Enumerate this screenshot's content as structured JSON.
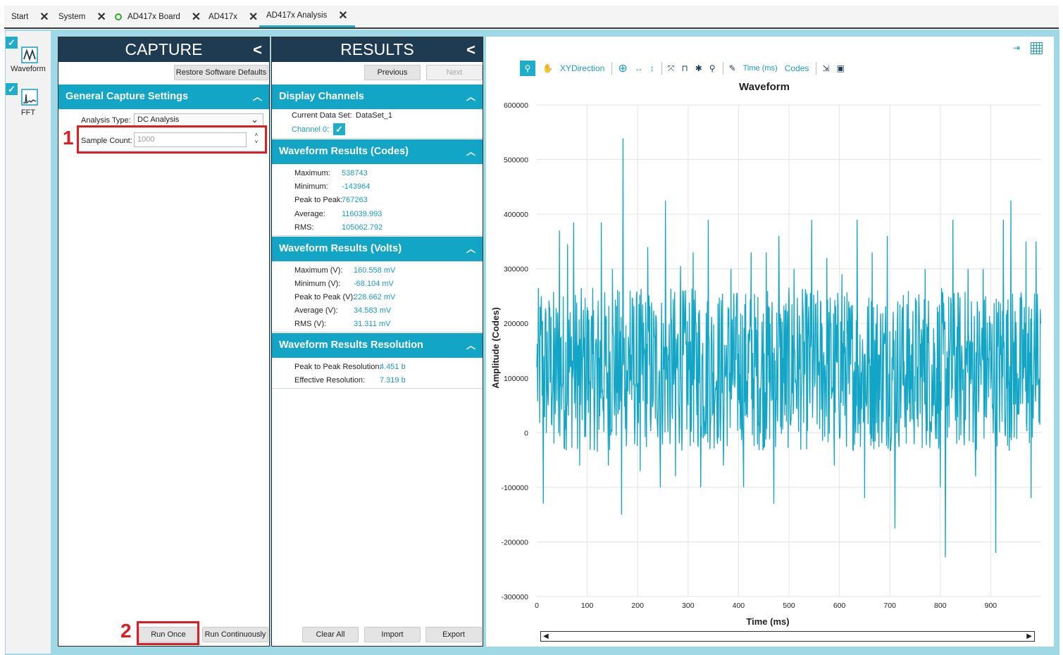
{
  "tabs": [
    {
      "label": "Start"
    },
    {
      "label": "System"
    },
    {
      "label": "AD417x Board"
    },
    {
      "label": "AD417x"
    },
    {
      "label": "AD417x Analysis"
    }
  ],
  "nav": {
    "waveform": "Waveform",
    "fft": "FFT"
  },
  "capture": {
    "title": "CAPTURE",
    "restore_label": "Restore Software Defaults",
    "section_title": "General Capture Settings",
    "analysis_type_label": "Analysis Type:",
    "analysis_type_value": "DC Analysis",
    "sample_count_label": "Sample Count:",
    "sample_count_value": "1000",
    "run_once_label": "Run Once",
    "run_continuously_label": "Run Continuously"
  },
  "annotations": {
    "marker1": "1",
    "marker2": "2"
  },
  "results": {
    "title": "RESULTS",
    "previous_label": "Previous",
    "next_label": "Next",
    "display_channels_title": "Display Channels",
    "current_dataset_label": "Current Data Set:",
    "current_dataset_value": "DataSet_1",
    "channel0_label": "Channel 0:",
    "codes_title": "Waveform Results (Codes)",
    "codes": [
      {
        "label": "Maximum:",
        "value": "538743"
      },
      {
        "label": "Minimum:",
        "value": "-143964"
      },
      {
        "label": "Peak to Peak:",
        "value": "767263"
      },
      {
        "label": "Average:",
        "value": "116039.993"
      },
      {
        "label": "RMS:",
        "value": "105062.792"
      }
    ],
    "volts_title": "Waveform Results (Volts)",
    "volts": [
      {
        "label": "Maximum (V):",
        "value": "160.558 mV"
      },
      {
        "label": "Minimum (V):",
        "value": "-68.104 mV"
      },
      {
        "label": "Peak to Peak (V):",
        "value": "228.662 mV"
      },
      {
        "label": "Average (V):",
        "value": "34.583 mV"
      },
      {
        "label": "RMS (V):",
        "value": "31.311 mV"
      }
    ],
    "resolution_title": "Waveform Results Resolution",
    "resolution": [
      {
        "label": "Peak to Peak Resolution:",
        "value": "4.451 b"
      },
      {
        "label": "Effective Resolution:",
        "value": "7.319 b"
      }
    ],
    "clear_all_label": "Clear All",
    "import_label": "Import",
    "export_label": "Export"
  },
  "toolbar": {
    "xydirection_label": "XYDirection",
    "time_label": "Time (ms)",
    "codes_label": "Codes"
  },
  "chart_data": {
    "type": "line",
    "title": "Waveform",
    "xlabel": "Time (ms)",
    "ylabel": "Amplitude (Codes)",
    "xlim": [
      0,
      1000
    ],
    "ylim": [
      -300000,
      600000
    ],
    "xticks": [
      0,
      100,
      200,
      300,
      400,
      500,
      600,
      700,
      800,
      900
    ],
    "yticks": [
      600000,
      500000,
      400000,
      300000,
      200000,
      100000,
      0,
      -100000,
      -200000,
      -300000
    ],
    "grid": true,
    "color": "#12a5c6",
    "series": [
      {
        "samples": 1000,
        "summary": {
          "max": 538743,
          "min": -143964,
          "mean": 116039.993,
          "rms": 105062.792
        },
        "points": [
          [
            0,
            120000
          ],
          [
            9,
            250000
          ],
          [
            13,
            -130000
          ],
          [
            25,
            230000
          ],
          [
            34,
            -20000
          ],
          [
            45,
            370000
          ],
          [
            55,
            -30000
          ],
          [
            61,
            345000
          ],
          [
            67,
            120000
          ],
          [
            73,
            385000
          ],
          [
            85,
            -60000
          ],
          [
            100,
            230000
          ],
          [
            110,
            80000
          ],
          [
            120,
            -35000
          ],
          [
            128,
            385000
          ],
          [
            142,
            -60000
          ],
          [
            150,
            300000
          ],
          [
            165,
            125000
          ],
          [
            168,
            -150000
          ],
          [
            171,
            538743
          ],
          [
            175,
            80000
          ],
          [
            185,
            260000
          ],
          [
            195,
            30000
          ],
          [
            205,
            -70000
          ],
          [
            220,
            340000
          ],
          [
            230,
            50000
          ],
          [
            245,
            -100000
          ],
          [
            255,
            425000
          ],
          [
            265,
            30000
          ],
          [
            275,
            -80000
          ],
          [
            285,
            305000
          ],
          [
            300,
            50000
          ],
          [
            310,
            330000
          ],
          [
            325,
            -100000
          ],
          [
            340,
            390000
          ],
          [
            355,
            80000
          ],
          [
            370,
            -60000
          ],
          [
            385,
            300000
          ],
          [
            400,
            60000
          ],
          [
            410,
            -100000
          ],
          [
            425,
            330000
          ],
          [
            440,
            20000
          ],
          [
            455,
            330000
          ],
          [
            470,
            -130000
          ],
          [
            480,
            360000
          ],
          [
            495,
            20000
          ],
          [
            510,
            300000
          ],
          [
            525,
            80000
          ],
          [
            545,
            390000
          ],
          [
            560,
            130000
          ],
          [
            575,
            320000
          ],
          [
            590,
            -60000
          ],
          [
            605,
            290000
          ],
          [
            620,
            70000
          ],
          [
            635,
            390000
          ],
          [
            650,
            -120000
          ],
          [
            665,
            330000
          ],
          [
            680,
            60000
          ],
          [
            695,
            360000
          ],
          [
            710,
            -175000
          ],
          [
            725,
            230000
          ],
          [
            740,
            20000
          ],
          [
            755,
            120000
          ],
          [
            770,
            300000
          ],
          [
            785,
            30000
          ],
          [
            800,
            -100000
          ],
          [
            810,
            -228000
          ],
          [
            825,
            390000
          ],
          [
            840,
            80000
          ],
          [
            855,
            300000
          ],
          [
            870,
            -80000
          ],
          [
            885,
            300000
          ],
          [
            900,
            80000
          ],
          [
            910,
            -220000
          ],
          [
            925,
            390000
          ],
          [
            940,
            425000
          ],
          [
            955,
            100000
          ],
          [
            970,
            350000
          ],
          [
            980,
            -120000
          ],
          [
            990,
            350000
          ],
          [
            999,
            200000
          ]
        ]
      }
    ]
  }
}
